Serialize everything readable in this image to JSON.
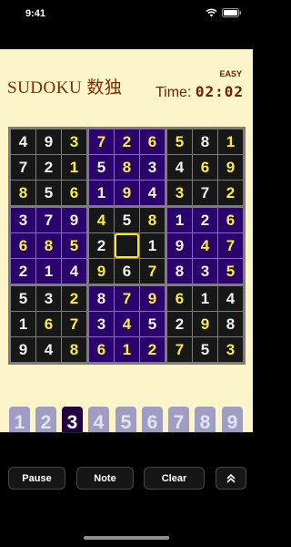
{
  "status_bar": {
    "time": "9:41"
  },
  "header": {
    "title": "SUDOKU 数独",
    "difficulty": "EASY",
    "time_label": "Time:",
    "time_value": "02:02"
  },
  "board": {
    "cells": [
      [
        {
          "v": "4",
          "t": "g"
        },
        {
          "v": "9",
          "t": "g"
        },
        {
          "v": "3",
          "t": "p"
        },
        {
          "v": "7",
          "t": "p"
        },
        {
          "v": "2",
          "t": "p"
        },
        {
          "v": "6",
          "t": "p"
        },
        {
          "v": "5",
          "t": "p"
        },
        {
          "v": "8",
          "t": "g"
        },
        {
          "v": "1",
          "t": "p"
        }
      ],
      [
        {
          "v": "7",
          "t": "g"
        },
        {
          "v": "2",
          "t": "g"
        },
        {
          "v": "1",
          "t": "p"
        },
        {
          "v": "5",
          "t": "g"
        },
        {
          "v": "8",
          "t": "p"
        },
        {
          "v": "3",
          "t": "g"
        },
        {
          "v": "4",
          "t": "g"
        },
        {
          "v": "6",
          "t": "p"
        },
        {
          "v": "9",
          "t": "p"
        }
      ],
      [
        {
          "v": "8",
          "t": "p"
        },
        {
          "v": "5",
          "t": "g"
        },
        {
          "v": "6",
          "t": "p"
        },
        {
          "v": "1",
          "t": "g"
        },
        {
          "v": "9",
          "t": "p"
        },
        {
          "v": "4",
          "t": "g"
        },
        {
          "v": "3",
          "t": "p"
        },
        {
          "v": "7",
          "t": "g"
        },
        {
          "v": "2",
          "t": "p"
        }
      ],
      [
        {
          "v": "3",
          "t": "g"
        },
        {
          "v": "7",
          "t": "g"
        },
        {
          "v": "9",
          "t": "g"
        },
        {
          "v": "4",
          "t": "p"
        },
        {
          "v": "5",
          "t": "g"
        },
        {
          "v": "8",
          "t": "p"
        },
        {
          "v": "1",
          "t": "g"
        },
        {
          "v": "2",
          "t": "g"
        },
        {
          "v": "6",
          "t": "p"
        }
      ],
      [
        {
          "v": "6",
          "t": "p"
        },
        {
          "v": "8",
          "t": "p"
        },
        {
          "v": "5",
          "t": "p"
        },
        {
          "v": "2",
          "t": "g"
        },
        {
          "v": "",
          "t": "g"
        },
        {
          "v": "1",
          "t": "g"
        },
        {
          "v": "9",
          "t": "g"
        },
        {
          "v": "4",
          "t": "p"
        },
        {
          "v": "7",
          "t": "p"
        }
      ],
      [
        {
          "v": "2",
          "t": "g"
        },
        {
          "v": "1",
          "t": "g"
        },
        {
          "v": "4",
          "t": "g"
        },
        {
          "v": "9",
          "t": "p"
        },
        {
          "v": "6",
          "t": "g"
        },
        {
          "v": "7",
          "t": "p"
        },
        {
          "v": "8",
          "t": "g"
        },
        {
          "v": "3",
          "t": "g"
        },
        {
          "v": "5",
          "t": "p"
        }
      ],
      [
        {
          "v": "5",
          "t": "g"
        },
        {
          "v": "3",
          "t": "g"
        },
        {
          "v": "2",
          "t": "p"
        },
        {
          "v": "8",
          "t": "g"
        },
        {
          "v": "7",
          "t": "p"
        },
        {
          "v": "9",
          "t": "p"
        },
        {
          "v": "6",
          "t": "p"
        },
        {
          "v": "1",
          "t": "g"
        },
        {
          "v": "4",
          "t": "g"
        }
      ],
      [
        {
          "v": "1",
          "t": "g"
        },
        {
          "v": "6",
          "t": "p"
        },
        {
          "v": "7",
          "t": "p"
        },
        {
          "v": "3",
          "t": "g"
        },
        {
          "v": "4",
          "t": "p"
        },
        {
          "v": "5",
          "t": "g"
        },
        {
          "v": "2",
          "t": "g"
        },
        {
          "v": "9",
          "t": "p"
        },
        {
          "v": "8",
          "t": "g"
        }
      ],
      [
        {
          "v": "9",
          "t": "g"
        },
        {
          "v": "4",
          "t": "g"
        },
        {
          "v": "8",
          "t": "p"
        },
        {
          "v": "6",
          "t": "p"
        },
        {
          "v": "1",
          "t": "p"
        },
        {
          "v": "2",
          "t": "p"
        },
        {
          "v": "7",
          "t": "p"
        },
        {
          "v": "5",
          "t": "g"
        },
        {
          "v": "3",
          "t": "p"
        }
      ]
    ],
    "selected": {
      "row": 4,
      "col": 4
    }
  },
  "number_pad": {
    "numbers": [
      "1",
      "2",
      "3",
      "4",
      "5",
      "6",
      "7",
      "8",
      "9"
    ],
    "active": "3"
  },
  "toolbar": {
    "pause_label": "Pause",
    "note_label": "Note",
    "clear_label": "Clear",
    "expand_icon": "double-chevron-up-icon"
  },
  "colors": {
    "background": "#fcf5c9",
    "title": "#7a2b00",
    "block_dark": "#171717",
    "block_purple": "#2a046c",
    "player_digit": "#ffee38",
    "given_digit": "#f2f2f2",
    "number_button": "#9f9dc4",
    "number_button_active": "#230040"
  }
}
